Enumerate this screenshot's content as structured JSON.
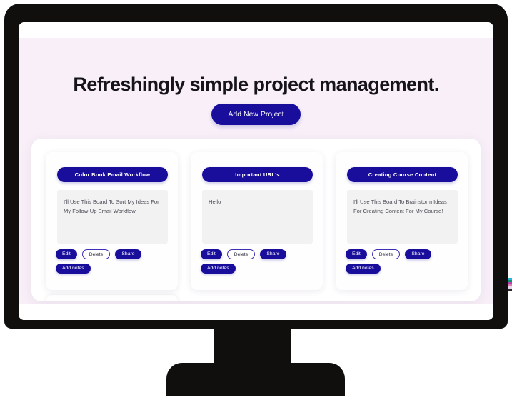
{
  "colors": {
    "brand_blue": "#190d9b",
    "hero_background": "#f8eff8",
    "panel_background": "#ffffff",
    "note_background": "#f2f2f2",
    "bezel": "#100f0e",
    "text_dark": "#16141a",
    "note_text": "#4c4c57"
  },
  "hero": {
    "title": "Refreshingly simple project management.",
    "add_project_label": "Add New Project"
  },
  "actions": {
    "edit": "Edit",
    "delete": "Delete",
    "share": "Share",
    "add_notes": "Add notes"
  },
  "boards": [
    {
      "title": "Color Book Email Workflow",
      "note": "I'll Use This Board To Sort My Ideas For My Follow-Up Email Workflow",
      "note_placeholder": "Add notes"
    },
    {
      "title": "Important URL's",
      "note": "Hello",
      "note_placeholder": "Add notes"
    },
    {
      "title": "Creating Course Content",
      "note": "I'll Use This Board To Brainstorm Ideas For Creating Content For My Course!",
      "note_placeholder": "Add notes"
    }
  ],
  "edge_sliver": {
    "swatches": [
      "#29b6d8",
      "#0f8f6a",
      "#b93fb0",
      "#e07ab0",
      "#e8d9ee",
      "#2a2a2a"
    ]
  }
}
